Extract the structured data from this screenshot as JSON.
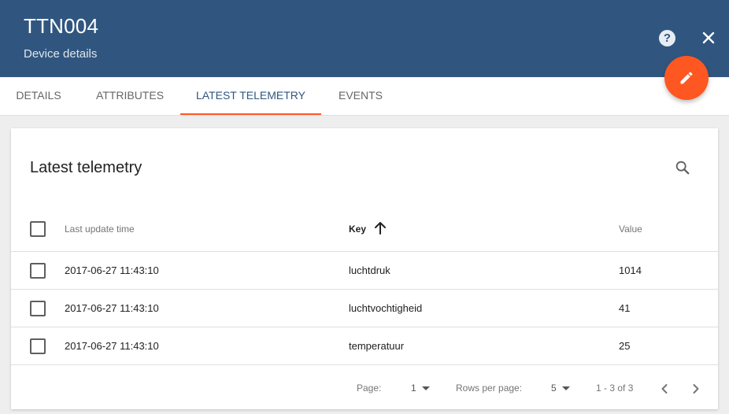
{
  "header": {
    "title": "TTN004",
    "subtitle": "Device details",
    "help_icon": "help-circle-icon",
    "close_icon": "close-icon",
    "fab_icon": "pencil-icon",
    "colors": {
      "bar": "#305680",
      "accent": "#ff5722"
    }
  },
  "tabs": [
    {
      "label": "DETAILS",
      "active": false
    },
    {
      "label": "ATTRIBUTES",
      "active": false
    },
    {
      "label": "LATEST TELEMETRY",
      "active": true
    },
    {
      "label": "EVENTS",
      "active": false
    }
  ],
  "card": {
    "title": "Latest telemetry",
    "search_icon": "search-icon",
    "columns": [
      {
        "label": "Last update time",
        "sorted": false
      },
      {
        "label": "Key",
        "sorted": true,
        "sort_icon": "arrow-up-icon"
      },
      {
        "label": "Value",
        "sorted": false
      }
    ],
    "rows": [
      {
        "time": "2017-06-27 11:43:10",
        "key": "luchtdruk",
        "value": "1014"
      },
      {
        "time": "2017-06-27 11:43:10",
        "key": "luchtvochtigheid",
        "value": "41"
      },
      {
        "time": "2017-06-27 11:43:10",
        "key": "temperatuur",
        "value": "25"
      }
    ],
    "footer": {
      "page_label": "Page:",
      "page_value": "1",
      "rows_label": "Rows per page:",
      "rows_value": "5",
      "range": "1 - 3 of 3",
      "prev_icon": "chevron-left-icon",
      "next_icon": "chevron-right-icon"
    }
  }
}
